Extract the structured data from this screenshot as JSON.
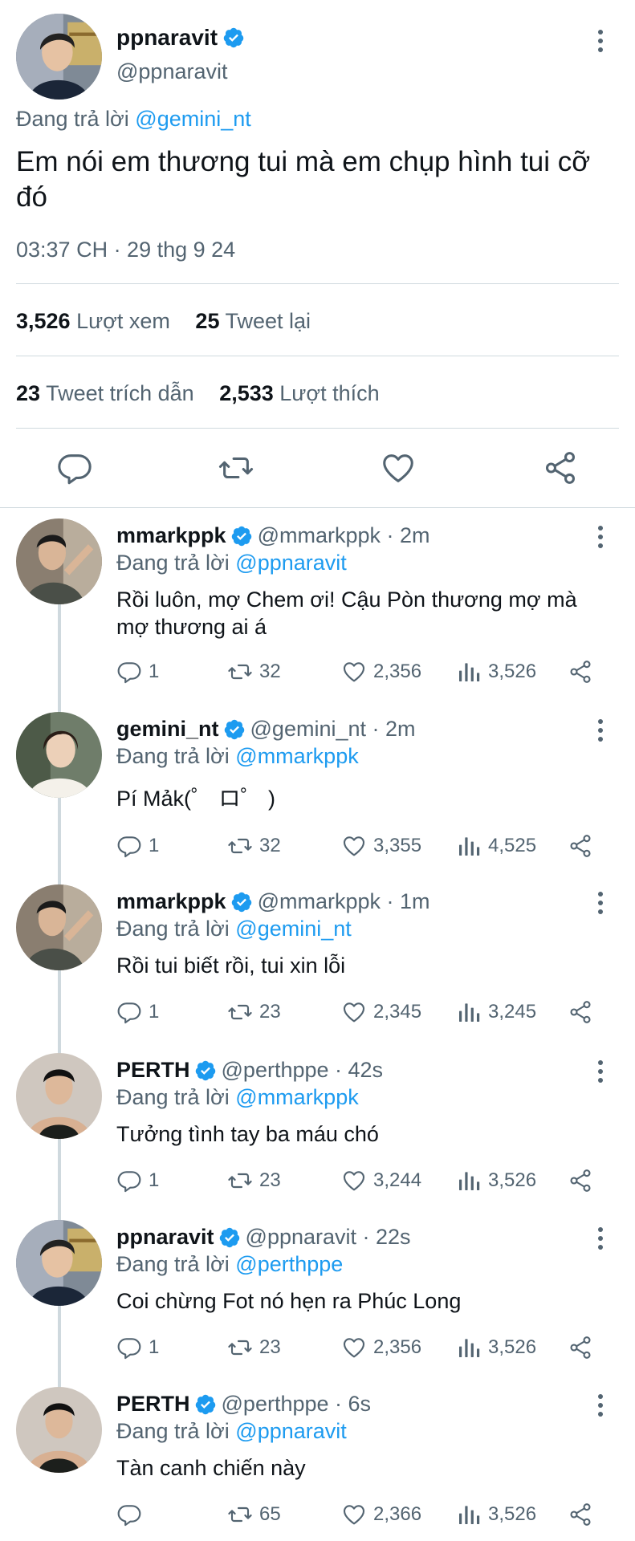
{
  "main_tweet": {
    "name": "ppnaravit",
    "handle": "@ppnaravit",
    "replying_label": "Đang trả lời",
    "replying_to": "@gemini_nt",
    "text": "Em nói em thương tui mà em chụp hình tui cỡ đó",
    "timestamp": "03:37 CH · 29 thg 9 24",
    "stats": {
      "views_count": "3,526",
      "views_label": "Lượt xem",
      "retweets_count": "25",
      "retweets_label": "Tweet lại",
      "quotes_count": "23",
      "quotes_label": "Tweet trích dẫn",
      "likes_count": "2,533",
      "likes_label": "Lượt thích"
    },
    "icons": [
      "comment-icon",
      "retweet-icon",
      "heart-icon",
      "share-icon"
    ]
  },
  "replies": [
    {
      "name": "mmarkppk",
      "handle": "@mmarkppk",
      "time": "2m",
      "replying_label": "Đang trả lời",
      "replying_to": "@ppnaravit",
      "text": "Rồi luôn, mợ Chem ơi! Cậu Pòn thương mợ mà mợ thương ai á",
      "comments": "1",
      "retweets": "32",
      "likes": "2,356",
      "views": "3,526"
    },
    {
      "name": "gemini_nt",
      "handle": "@gemini_nt",
      "time": "2m",
      "replying_label": "Đang trả lời",
      "replying_to": "@mmarkppk",
      "text": "Pí Mảk(゜ ロ゜ )",
      "comments": "1",
      "retweets": "32",
      "likes": "3,355",
      "views": "4,525"
    },
    {
      "name": "mmarkppk",
      "handle": "@mmarkppk",
      "time": "1m",
      "replying_label": "Đang trả lời",
      "replying_to": "@gemini_nt",
      "text": "Rồi tui biết rồi, tui xin lỗi",
      "comments": "1",
      "retweets": "23",
      "likes": "2,345",
      "views": "3,245"
    },
    {
      "name": "PERTH",
      "handle": "@perthppe",
      "time": "42s",
      "replying_label": "Đang trả lời",
      "replying_to": "@mmarkppk",
      "text": "Tưởng tình tay ba máu chó",
      "comments": "1",
      "retweets": "23",
      "likes": "3,244",
      "views": "3,526"
    },
    {
      "name": "ppnaravit",
      "handle": "@ppnaravit",
      "time": "22s",
      "replying_label": "Đang trả lời",
      "replying_to": "@perthppe",
      "text": "Coi chừng Fot nó hẹn ra Phúc Long",
      "comments": "1",
      "retweets": "23",
      "likes": "2,356",
      "views": "3,526"
    },
    {
      "name": "PERTH",
      "handle": "@perthppe",
      "time": "6s",
      "replying_label": "Đang trả lời",
      "replying_to": "@ppnaravit",
      "text": "Tàn canh chiến này",
      "comments": "",
      "retweets": "65",
      "likes": "2,366",
      "views": "3,526"
    }
  ],
  "colors": {
    "accent": "#1d9bf0",
    "text": "#0f1419",
    "muted": "#536471",
    "divider": "#cfd9de"
  }
}
